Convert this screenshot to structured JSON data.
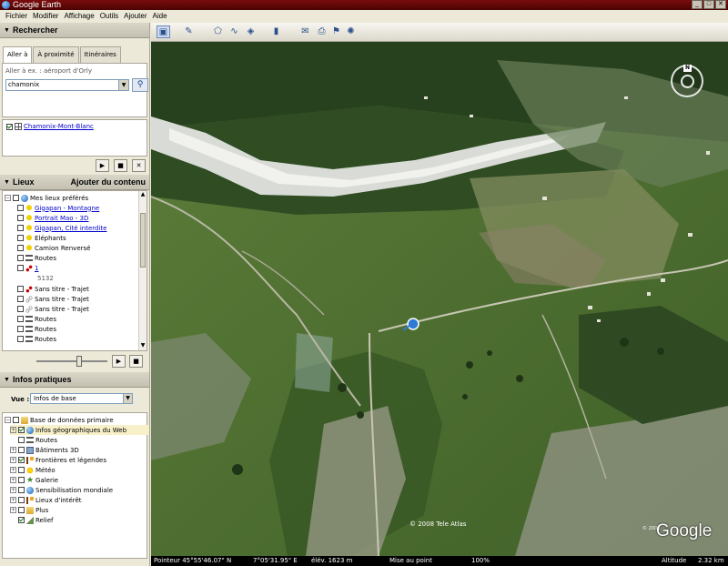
{
  "window": {
    "title": "Google Earth",
    "controls": [
      "_",
      "□",
      "✕"
    ]
  },
  "menu": [
    "Fichier",
    "Modifier",
    "Affichage",
    "Outils",
    "Ajouter",
    "Aide"
  ],
  "search": {
    "header": "Rechercher",
    "tabs": [
      "Aller à",
      "À proximité",
      "Itinéraires"
    ],
    "hint": "Aller à ex. : aéroport d'Orly",
    "value": "chamonix",
    "result": "Chamonix-Mont-Blanc"
  },
  "places": {
    "header": "Lieux",
    "add_content": "Ajouter du contenu",
    "root": "Mes lieux préférés",
    "items": [
      {
        "label": "Gigapan - Montagne",
        "icon": "pushpin-icon",
        "link": true
      },
      {
        "label": "Portrait Mao - 3D",
        "icon": "pushpin-icon",
        "link": true
      },
      {
        "label": "Gigapan, Cité interdite",
        "icon": "pushpin-icon",
        "link": true
      },
      {
        "label": "Eléphants",
        "icon": "pushpin-icon",
        "link": false
      },
      {
        "label": "Camion Renversé",
        "icon": "pushpin-icon",
        "link": false
      },
      {
        "label": "Routes",
        "icon": "route-icon",
        "link": false
      },
      {
        "label": "1",
        "icon": "path-icon",
        "link": true
      },
      {
        "label": "5132",
        "icon": "",
        "link": false
      },
      {
        "label": "Sans titre - Trajet",
        "icon": "path-icon",
        "link": false
      },
      {
        "label": "Sans titre - Trajet",
        "icon": "path-outline-icon",
        "link": false
      },
      {
        "label": "Sans titre - Trajet",
        "icon": "path-outline-icon",
        "link": false
      },
      {
        "label": "Routes",
        "icon": "route-icon",
        "link": false
      },
      {
        "label": "Routes",
        "icon": "route-icon",
        "link": false
      },
      {
        "label": "Routes",
        "icon": "route-icon",
        "link": false
      }
    ]
  },
  "layers": {
    "header": "Infos pratiques",
    "view_label": "Vue :",
    "view_value": "Infos de base",
    "root": "Base de données primaire",
    "items": [
      {
        "label": "Infos géographiques du Web",
        "checked": true
      },
      {
        "label": "Routes",
        "checked": false
      },
      {
        "label": "Bâtiments 3D",
        "checked": false
      },
      {
        "label": "Frontières et légendes",
        "checked": true
      },
      {
        "label": "Météo",
        "checked": false
      },
      {
        "label": "Galerie",
        "checked": false
      },
      {
        "label": "Sensibilisation mondiale",
        "checked": false
      },
      {
        "label": "Lieux d'intérêt",
        "checked": false
      },
      {
        "label": "Plus",
        "checked": false
      },
      {
        "label": "Relief",
        "checked": true
      }
    ]
  },
  "map": {
    "copyright": "© 2008 Tele Atlas",
    "copyright2": "© 2008",
    "logo": "Google",
    "compass_n": "N"
  },
  "status": {
    "pointer": "Pointeur  45°55'46.07\" N",
    "lon": "7°05'31.95\" E",
    "elev": "élév.  1623 m",
    "stream": "Mise au point",
    "pct": "100%",
    "alt": "Altitude",
    "alt_value": "2.32 km"
  }
}
